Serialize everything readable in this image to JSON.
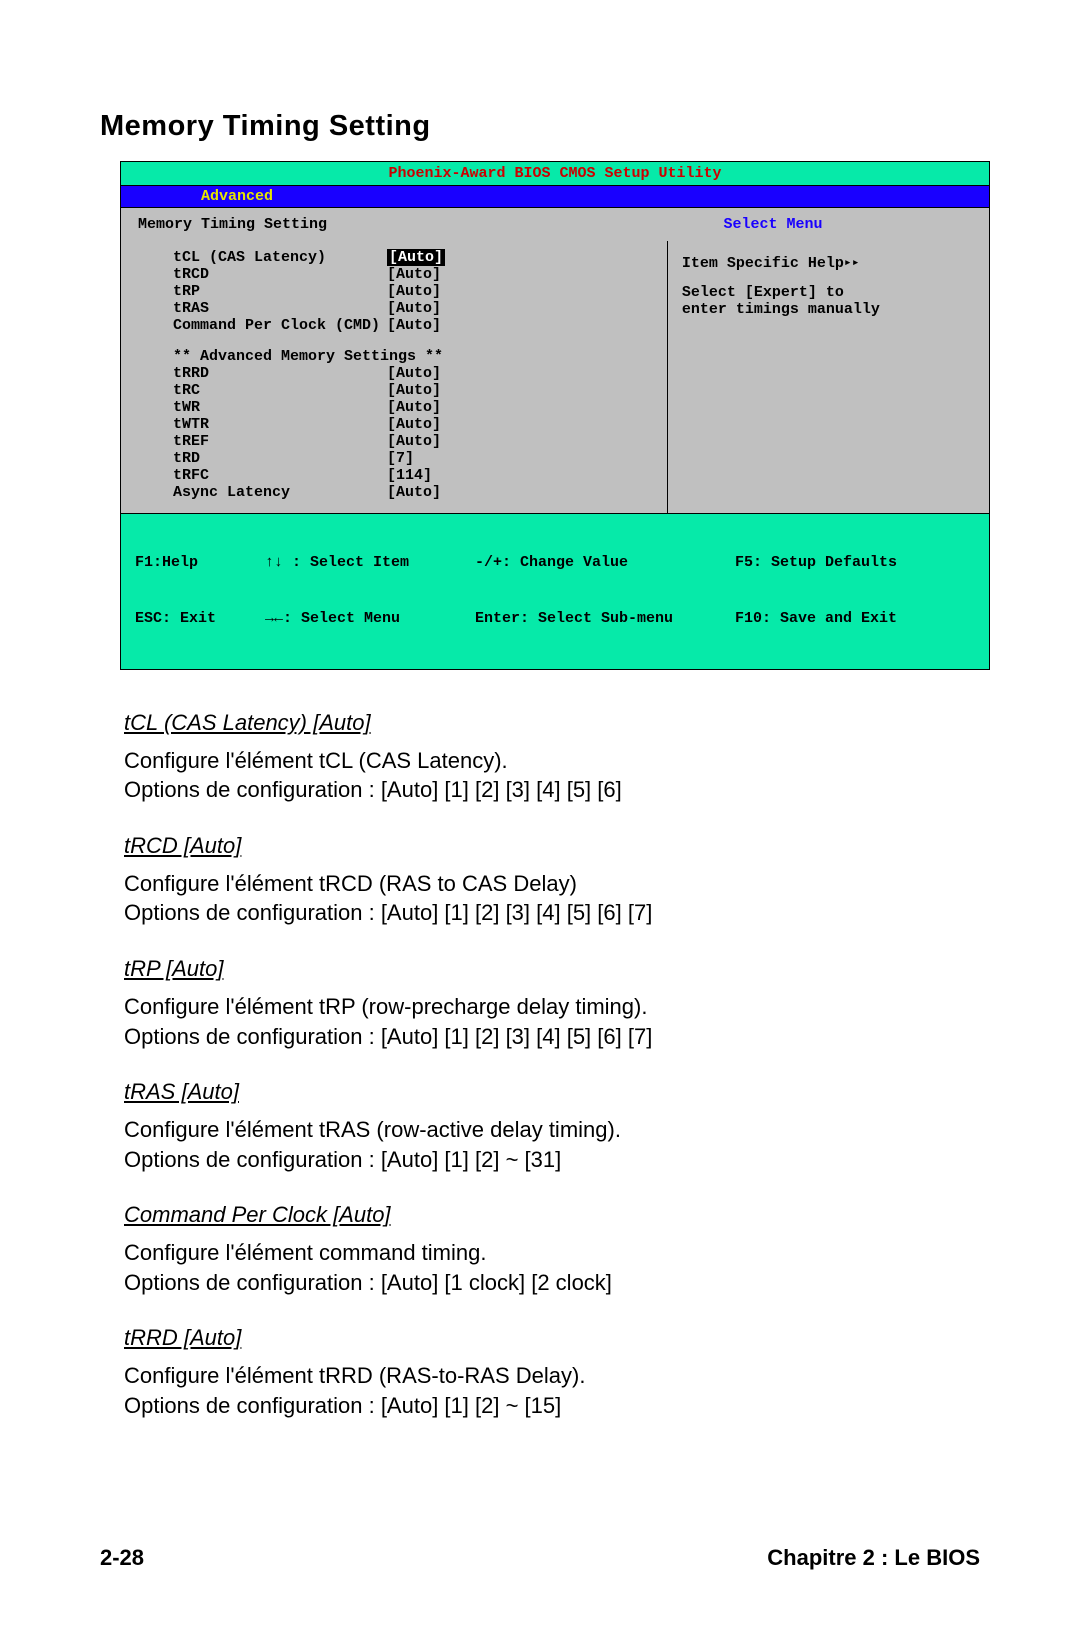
{
  "title": "Memory Timing Setting",
  "bios": {
    "header": "Phoenix-Award BIOS CMOS Setup Utility",
    "tab": "Advanced",
    "subtitle_left": "Memory Timing Setting",
    "subtitle_right": "Select Menu",
    "settings_main": [
      {
        "label": "tCL (CAS Latency)",
        "value": "[Auto]",
        "selected": true
      },
      {
        "label": "tRCD",
        "value": "[Auto]"
      },
      {
        "label": "tRP",
        "value": "[Auto]"
      },
      {
        "label": "tRAS",
        "value": "[Auto]"
      },
      {
        "label": "Command Per Clock (CMD)",
        "value": "[Auto]"
      }
    ],
    "adv_header": "** Advanced Memory Settings **",
    "settings_adv": [
      {
        "label": "tRRD",
        "value": "[Auto]"
      },
      {
        "label": "tRC",
        "value": "[Auto]"
      },
      {
        "label": "tWR",
        "value": "[Auto]"
      },
      {
        "label": "tWTR",
        "value": "[Auto]"
      },
      {
        "label": "tREF",
        "value": "[Auto]"
      },
      {
        "label": "tRD",
        "value": "[7]"
      },
      {
        "label": "tRFC",
        "value": "[114]"
      },
      {
        "label": "Async Latency",
        "value": "[Auto]"
      }
    ],
    "help_title": "Item Specific Help",
    "help_body_l1": "Select [Expert] to",
    "help_body_l2": "enter timings manually",
    "footer": {
      "r1c1": "F1:Help",
      "r1c2": "↑↓ : Select Item",
      "r1c3": "-/+: Change Value",
      "r1c4": "F5: Setup Defaults",
      "r2c1": "ESC: Exit",
      "r2c2": "→←: Select Menu",
      "r2c3": "Enter: Select Sub-menu",
      "r2c4": "F10: Save and Exit"
    }
  },
  "descriptions": [
    {
      "heading": "tCL (CAS Latency) [Auto]",
      "lines": [
        "Configure l'élément tCL (CAS Latency).",
        "Options de configuration : [Auto] [1] [2] [3] [4] [5] [6]"
      ]
    },
    {
      "heading": "tRCD [Auto]",
      "lines": [
        "Configure l'élément tRCD (RAS to CAS Delay)",
        "Options de configuration : [Auto] [1] [2] [3] [4] [5] [6] [7]"
      ]
    },
    {
      "heading": "tRP [Auto]",
      "lines": [
        "Configure l'élément tRP (row-precharge delay timing).",
        "Options de configuration : [Auto] [1] [2] [3] [4] [5] [6] [7]"
      ]
    },
    {
      "heading": "tRAS [Auto]",
      "lines": [
        "Configure l'élément tRAS (row-active delay timing).",
        "Options de configuration : [Auto] [1] [2] ~ [31]"
      ]
    },
    {
      "heading": "Command Per Clock [Auto]",
      "lines": [
        "Configure l'élément command timing.",
        "Options de configuration : [Auto] [1 clock] [2 clock]"
      ]
    },
    {
      "heading": "tRRD [Auto]",
      "lines": [
        "Configure l'élément tRRD (RAS-to-RAS Delay).",
        "Options de configuration : [Auto] [1] [2] ~ [15]"
      ]
    }
  ],
  "page_footer": {
    "left": "2-28",
    "right": "Chapitre 2 : Le BIOS"
  }
}
